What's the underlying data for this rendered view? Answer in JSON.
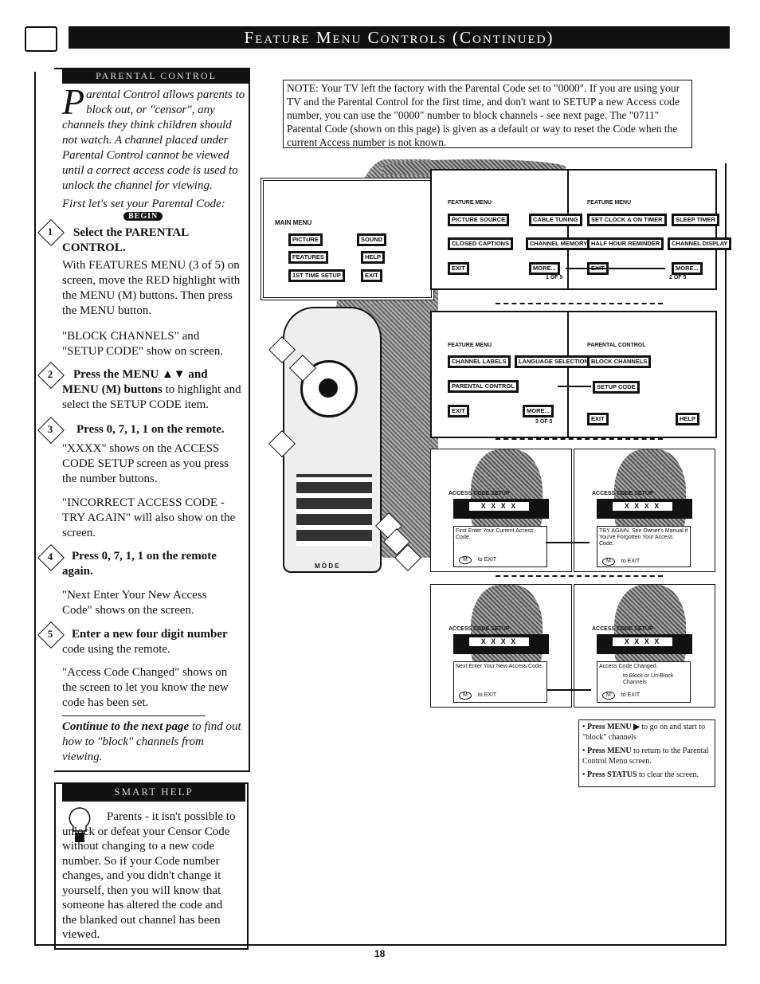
{
  "header": {
    "title": "Feature Menu Controls (Continued)"
  },
  "parental": {
    "section_title": "Parental Control",
    "intro": "arental Control allows parents to block out, or \"censor\", any channels they think children should not watch. A channel placed under Parental Control cannot be viewed until a correct access code is used to unlock the channel for viewing.",
    "intro_dropcap": "P",
    "first": "First let's set your Parental Code:",
    "begin": "BEGIN",
    "steps": [
      {
        "num": "1",
        "title": "Select the PARENTAL CONTROL.",
        "body": "With FEATURES MENU (3 of 5) on screen, move the RED highlight with the MENU (M) buttons. Then press the MENU button.",
        "extra": "\"BLOCK CHANNELS\" and \"SETUP CODE\" show on screen."
      },
      {
        "num": "2",
        "title": "Press the MENU ▲▼ and MENU (M) buttons",
        "body": "to highlight and select the SETUP CODE item."
      },
      {
        "num": "3",
        "title": "Press 0, 7, 1, 1 on the remote.",
        "body": "\"XXXX\" shows on the ACCESS CODE SETUP screen as you press the number buttons.",
        "extra": "\"INCORRECT ACCESS CODE - TRY AGAIN\" will also show on the screen."
      },
      {
        "num": "4",
        "title": "Press 0, 7, 1, 1 on the remote again.",
        "body": "\"Next Enter Your New Access Code\" shows on the screen."
      },
      {
        "num": "5",
        "title": "Enter a new four digit number",
        "body": "code using the remote.",
        "extra": "\"Access Code Changed\" shows on the screen to let you know the new code has been set."
      }
    ],
    "continue_bold": "Continue to the next page",
    "continue_rest": "to find out how to \"block\" channels from viewing."
  },
  "smart_help": {
    "title": "Smart Help",
    "text": "Parents - it isn't possible to unlock or defeat your Censor Code without changing to a new code number. So if your Code number changes, and you didn't change it yourself, then you will know that someone has altered the code and the blanked out channel has been viewed."
  },
  "note": "NOTE: Your TV left the factory with the Parental Code set to \"0000\". If you are using your TV and the Parental Control for the first time, and don't want to SETUP a new Access code number, you can use the \"0000\" number to block channels - see next page. The \"0711\" Parental Code (shown on this page) is given as a default or way to reset the Code when the current Access number is not known.",
  "main_menu": {
    "title": "MAIN MENU",
    "items": [
      "PICTURE",
      "SOUND",
      "FEATURES",
      "HELP",
      "1ST TIME SETUP",
      "EXIT"
    ]
  },
  "feature1": {
    "title": "FEATURE MENU",
    "items": [
      "PICTURE SOURCE",
      "CABLE TUNING",
      "CLOSED CAPTIONS",
      "CHANNEL MEMORY",
      "EXIT",
      "MORE..."
    ],
    "page": "1 OF 5"
  },
  "feature2": {
    "title": "FEATURE MENU",
    "items": [
      "SET CLOCK & ON TIMER",
      "SLEEP TIMER",
      "HALF HOUR REMINDER",
      "CHANNEL DISPLAY",
      "EXIT",
      "MORE..."
    ],
    "page": "2 OF 5"
  },
  "feature3": {
    "title": "FEATURE MENU",
    "items": [
      "CHANNEL LABELS",
      "LANGUAGE SELECTION",
      "PARENTAL CONTROL",
      "EXIT",
      "MORE..."
    ],
    "page": "3 OF 5"
  },
  "parental_menu": {
    "title": "PARENTAL CONTROL",
    "items": [
      "BLOCK CHANNELS",
      "SETUP CODE",
      "EXIT",
      "HELP"
    ]
  },
  "access_screens": [
    {
      "title": "ACCESS CODE SETUP",
      "code": "X X X X",
      "msg": "First Enter Your Current Access Code.",
      "exit": "to EXIT",
      "m": "M"
    },
    {
      "title": "ACCESS CODE SETUP",
      "code": "X X X X",
      "msg": "TRY AGAIN. See Owner's Manual if You've Forgotten Your Access Code.",
      "exit": "to EXIT",
      "m": "M"
    },
    {
      "title": "ACCESS CODE SETUP",
      "code": "X X X X",
      "msg": "Next Enter Your New Access Code.",
      "exit": "to EXIT",
      "m": "M"
    },
    {
      "title": "ACCESS CODE SETUP",
      "code": "X X X X",
      "msg": "Access Code Changed.",
      "block": "to Block or Un-Block Channels",
      "exit": "to EXIT",
      "m": "M"
    }
  ],
  "bullets": [
    {
      "bold": "Press MENU ▶",
      "rest": "to go on and start to \"block\" channels"
    },
    {
      "bold": "Press MENU",
      "rest": "to return to the Parental Control Menu screen."
    },
    {
      "bold": "Press STATUS",
      "rest": "to clear the screen."
    }
  ],
  "remote": {
    "mode": "M O D E"
  },
  "page_number": "18"
}
